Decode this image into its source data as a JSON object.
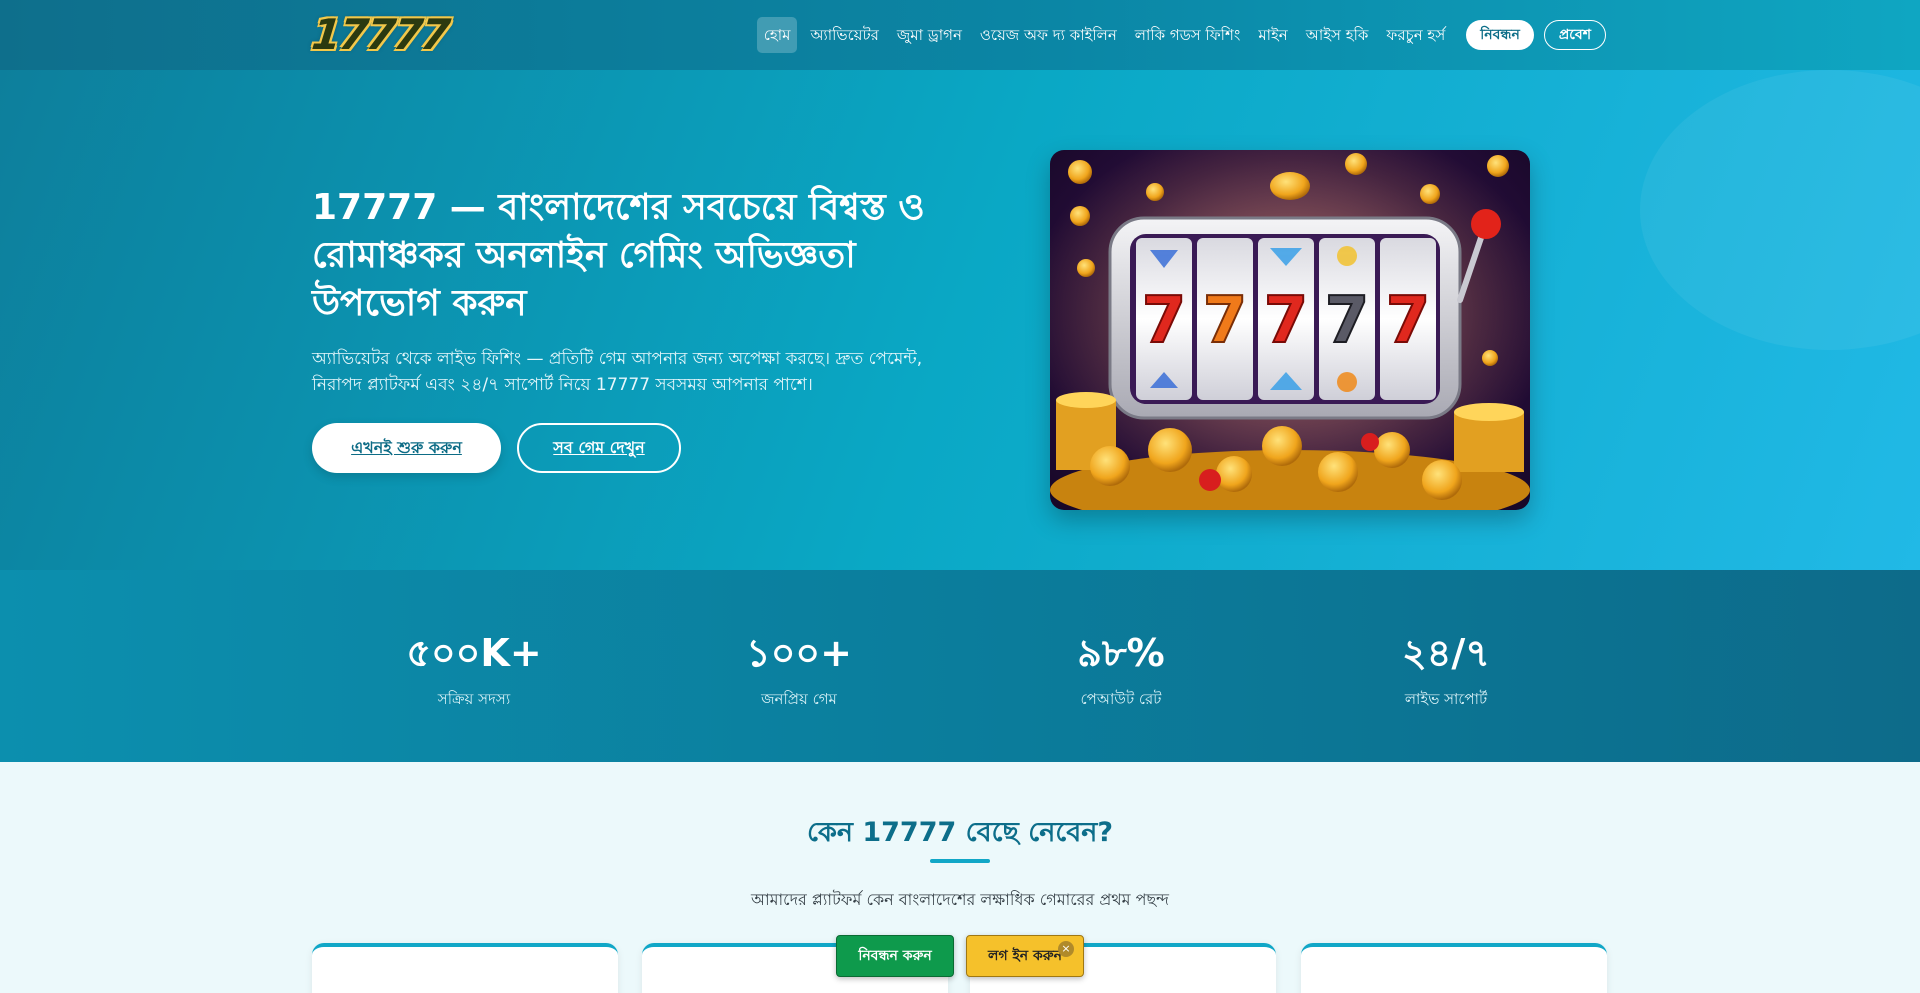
{
  "header": {
    "logo_text": "17777",
    "nav": [
      {
        "label": "হোম",
        "active": true
      },
      {
        "label": "অ্যাভিয়েটর"
      },
      {
        "label": "জুমা ড্রাগন"
      },
      {
        "label": "ওয়েজ অফ দ্য কাইলিন"
      },
      {
        "label": "লাকি গডস ফিশিং"
      },
      {
        "label": "মাইন"
      },
      {
        "label": "আইস হকি"
      },
      {
        "label": "ফরচুন হর্স"
      }
    ],
    "register_label": "নিবন্ধন",
    "login_label": "প্রবেশ"
  },
  "hero": {
    "title": "17777 — বাংলাদেশের সবচেয়ে বিশ্বস্ত ও রোমাঞ্চকর অনলাইন গেমিং অভিজ্ঞতা উপভোগ করুন",
    "description": "অ্যাভিয়েটর থেকে লাইভ ফিশিং — প্রতিটি গেম আপনার জন্য অপেক্ষা করছে। দ্রুত পেমেন্ট, নিরাপদ প্ল্যাটফর্ম এবং ২৪/৭ সাপোর্ট নিয়ে 17777 সবসময় আপনার পাশে।",
    "start_button": "এখনই শুরু করুন",
    "games_button": "সব গেম দেখুন",
    "slot_symbols": [
      "7",
      "7",
      "7",
      "7",
      "7"
    ]
  },
  "stats": [
    {
      "value": "৫০০K+",
      "label": "সক্রিয় সদস্য"
    },
    {
      "value": "১০০+",
      "label": "জনপ্রিয় গেম"
    },
    {
      "value": "৯৮%",
      "label": "পেআউট রেট"
    },
    {
      "value": "২৪/৭",
      "label": "লাইভ সাপোর্ট"
    }
  ],
  "why": {
    "title": "কেন 17777 বেছে নেবেন?",
    "subtitle": "আমাদের প্ল্যাটফর্ম কেন বাংলাদেশের লক্ষাধিক গেমারের প্রথম পছন্দ"
  },
  "floating": {
    "register_label": "নিবন্ধন করুন",
    "login_label": "লগ ইন করুন",
    "close_symbol": "×"
  },
  "colors": {
    "primary": "#0b86a5",
    "accent": "#11a7c7",
    "register_green": "#0e9a4c",
    "login_yellow": "#f5c12b"
  }
}
